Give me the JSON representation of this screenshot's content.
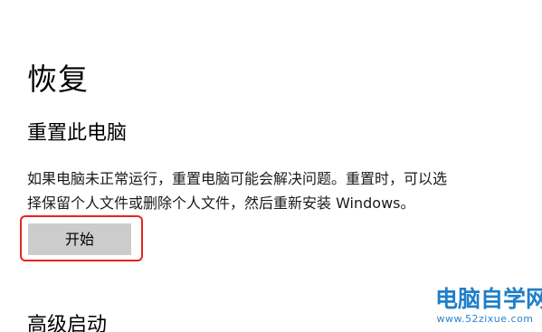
{
  "page": {
    "title": "恢复"
  },
  "reset_pc": {
    "heading": "重置此电脑",
    "description_lines": [
      "如果电脑未正常运行，重置电脑可能会解决问题。重置时，可以选",
      "择保留个人文件或删除个人文件，然后重新安装 Windows。"
    ],
    "start_button_label": "开始"
  },
  "advanced_startup": {
    "heading": "高级启动"
  },
  "watermark": {
    "name": "电脑自学网",
    "url": "www.52zixue.com"
  },
  "colors": {
    "background": "#ffffff",
    "button_bg": "#cccccc",
    "highlight_border": "#e8231f",
    "watermark_blue": "#1f7fc8"
  }
}
